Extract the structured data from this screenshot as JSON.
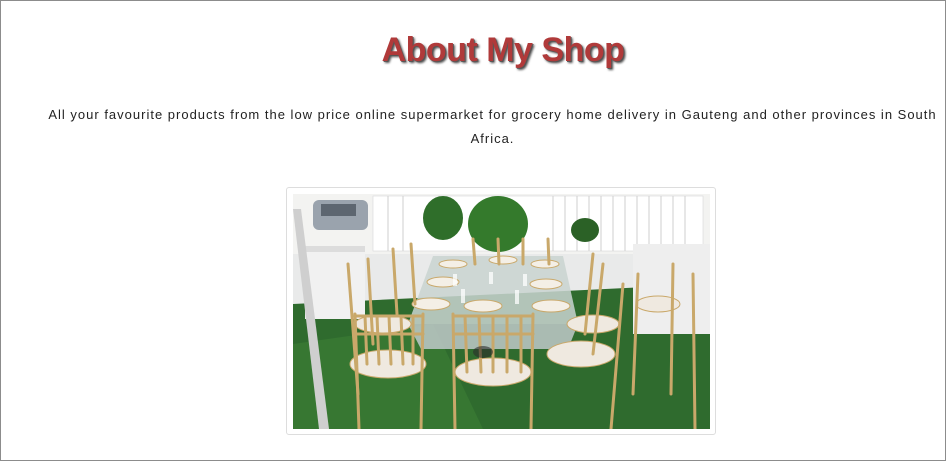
{
  "about": {
    "title": "About My Shop",
    "description": "All your favourite products from the low price online supermarket for grocery home delivery in Gauteng and other provinces in South Africa."
  },
  "photo": {
    "subject": "event-table-setting",
    "colors": {
      "grass": "#2f6b2e",
      "chair": "#c9a86a",
      "cushion": "#efe9e0",
      "tent": "#f4f4f2"
    }
  }
}
